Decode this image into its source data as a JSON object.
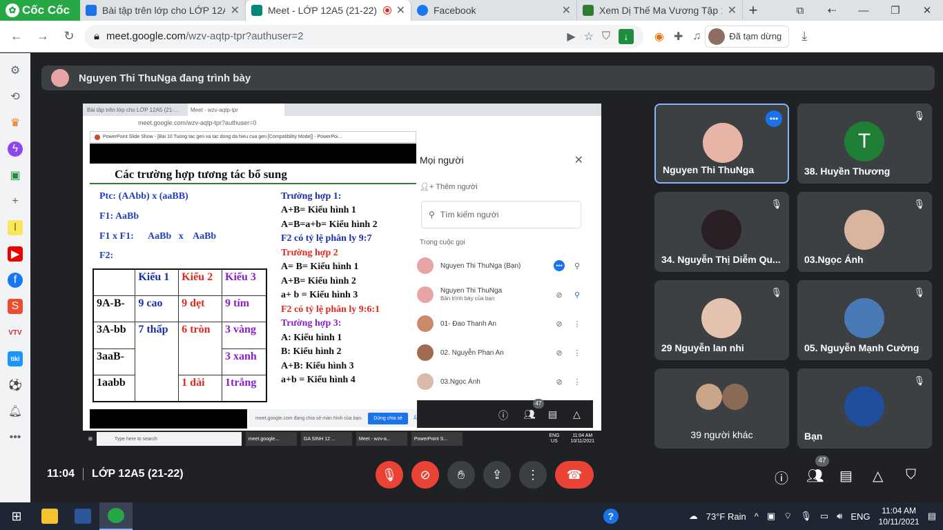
{
  "browser": {
    "brand": "Cốc Cốc",
    "tabs": [
      {
        "title": "Bài tập trên lớp cho LỚP 12A",
        "color": "#1a73e8"
      },
      {
        "title": "Meet - LỚP 12A5 (21-22)",
        "color": "#00897b"
      },
      {
        "title": "Facebook",
        "color": "#1877f2"
      },
      {
        "title": "Xem Dị Thế Ma Vương Tập 1",
        "color": "#2e7d32"
      }
    ],
    "url": "meet.google.com",
    "url_path": "/wzv-aqtp-tpr?authuser=2",
    "profile_label": "Đã tạm dừng"
  },
  "meet": {
    "presenter_banner": "Nguyen Thi ThuNga đang trình bày",
    "meeting_time": "11:04",
    "meeting_name": "LỚP 12A5 (21-22)",
    "participant_count": "47"
  },
  "shared_screen": {
    "inner_tabs": [
      "Bài tập trên lớp cho LỚP 12A5 (21-...",
      "Meet - wzv-aqtp-tpr"
    ],
    "inner_url": "meet.google.com/wzv-aqtp-tpr?authuser=0",
    "ppt_window_title": "PowerPoint Slide Show - [Bai 10 Tuong tac gen va tac dong da hieu cua gen [Compatibility Mode]] - PowerPoi...",
    "slide": {
      "title": "Các trường hợp tương tác bổ sung",
      "left_lines": [
        "Ptc: (AAbb)  x (aaBB)",
        "F1:                      AaBb",
        "F1 x F1:      AaBb   x    AaBb",
        "F2:"
      ],
      "table_header": [
        "",
        "Kiểu 1",
        "Kiểu 2",
        "Kiểu 3"
      ],
      "table_rows": [
        [
          "9A-B-",
          "9 cao",
          "9 dẹt",
          "9 tím"
        ],
        [
          "3A-bb",
          "7 thấp",
          "6 tròn",
          "3 vàng"
        ],
        [
          "3aaB-",
          "",
          "",
          "3 xanh"
        ],
        [
          "1aabb",
          "",
          "1 dài",
          "1trắng"
        ]
      ],
      "right_lines": [
        {
          "text": "Trường hợp 1:",
          "color": "blue"
        },
        {
          "text": "A+B= Kiểu hình 1",
          "color": "black"
        },
        {
          "text": "A=B=a+b= Kiểu hình 2",
          "color": "black"
        },
        {
          "text": "F2 có tỷ lệ phân ly 9:7",
          "color": "blue"
        },
        {
          "text": "Trường hợp 2",
          "color": "red"
        },
        {
          "text": "A= B= Kiểu hình 1",
          "color": "black"
        },
        {
          "text": "A+B= Kiểu hình 2",
          "color": "black"
        },
        {
          "text": "a+ b = Kiểu hình 3",
          "color": "black"
        },
        {
          "text": "F2 có tỷ lệ phân ly 9:6:1",
          "color": "red"
        },
        {
          "text": "Trường hợp 3:",
          "color": "purple"
        },
        {
          "text": "A: Kiểu hình 1",
          "color": "black"
        },
        {
          "text": "B: Kiểu hình 2",
          "color": "black"
        },
        {
          "text": "A+B: Kiểu hình 3",
          "color": "black"
        },
        {
          "text": "a+b = Kiểu hình 4",
          "color": "black"
        }
      ]
    },
    "share_notice": "meet.google.com đang chia sẻ màn hình của bạn.",
    "share_stop": "Dừng chia sẻ",
    "share_hide": "Ẩn",
    "people_panel": {
      "title": "Mọi người",
      "add": "Thêm người",
      "search_placeholder": "Tìm kiếm người",
      "in_call": "Trong cuộc gọi",
      "rows": [
        {
          "name": "Nguyen Thi ThuNga (Bạn)",
          "sub": ""
        },
        {
          "name": "Nguyen Thi ThuNga",
          "sub": "Bản trình bày của bạn"
        },
        {
          "name": "01- Đao Thanh An",
          "sub": ""
        },
        {
          "name": "02. Nguyễn Phan An",
          "sub": ""
        },
        {
          "name": "03.Ngọc Ánh",
          "sub": ""
        }
      ],
      "count": "47"
    },
    "taskbar": {
      "search": "Type here to search",
      "items": [
        "meet.google...",
        "GA SINH 12 ...",
        "Meet - wzv-a...",
        "PowerPoint S..."
      ],
      "lang": "ENG",
      "region": "US",
      "time": "11:04 AM",
      "date": "10/11/2021"
    }
  },
  "tiles": [
    {
      "name": "Nguyen Thi ThuNga",
      "type": "speaker"
    },
    {
      "name": "38. Huyền Thương",
      "letter": "T"
    },
    {
      "name": "34. Nguyễn Thị Diễm Qu..."
    },
    {
      "name": "03.Ngọc Ánh"
    },
    {
      "name": "29 Nguyễn lan nhi"
    },
    {
      "name": "05. Nguyễn Mạnh Cường"
    },
    {
      "name": "39 người khác"
    },
    {
      "name": "Bạn"
    }
  ],
  "windows_taskbar": {
    "weather": "73°F  Rain",
    "lang": "ENG",
    "time": "11:04 AM",
    "date": "10/11/2021"
  }
}
